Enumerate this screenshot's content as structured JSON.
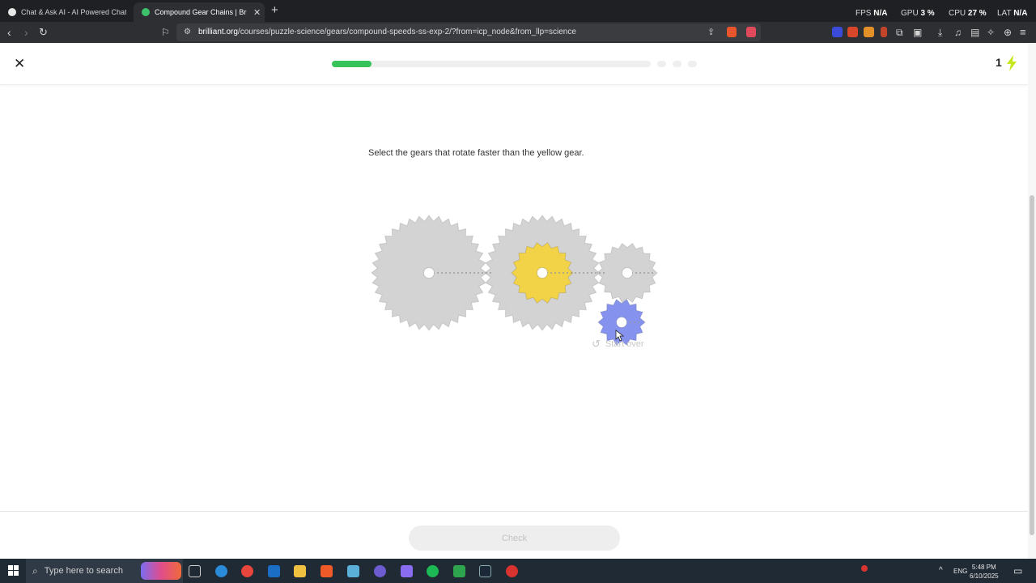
{
  "browser": {
    "tabs": [
      {
        "title": "Chat & Ask AI - AI Powered Chat Bot",
        "active": false
      },
      {
        "title": "Compound Gear Chains | Brilliant",
        "active": true
      }
    ],
    "stats": {
      "fps_label": "FPS",
      "fps_value": "N/A",
      "gpu_label": "GPU",
      "gpu_value": "3 %",
      "cpu_label": "CPU",
      "cpu_value": "27 %",
      "lat_label": "LAT",
      "lat_value": "N/A"
    },
    "url_host": "brilliant.org",
    "url_path": "/courses/puzzle-science/gears/compound-speeds-ss-exp-2/?from=icp_node&from_llp=science"
  },
  "lesson": {
    "progress_fraction": 0.125,
    "streak_count": "1",
    "prompt": "Select the gears that rotate faster than the yellow gear.",
    "start_over_label": "Start over",
    "check_label": "Check"
  },
  "gears": [
    {
      "name": "large-gray-gear",
      "color": "#d3d3d3"
    },
    {
      "name": "middle-gray-gear",
      "color": "#d3d3d3"
    },
    {
      "name": "yellow-gear",
      "color": "#f2d246"
    },
    {
      "name": "small-gray-gear",
      "color": "#d3d3d3"
    },
    {
      "name": "blue-gear",
      "color": "#8693ee"
    }
  ],
  "colors": {
    "progress": "#35c35a",
    "bolt": "#c6e61d",
    "yellow_gear": "#f2d246",
    "blue_gear": "#8693ee"
  },
  "taskbar": {
    "search_placeholder": "Type here to search",
    "lang": "ENG",
    "time": "5:48 PM",
    "date": "6/10/2025"
  }
}
